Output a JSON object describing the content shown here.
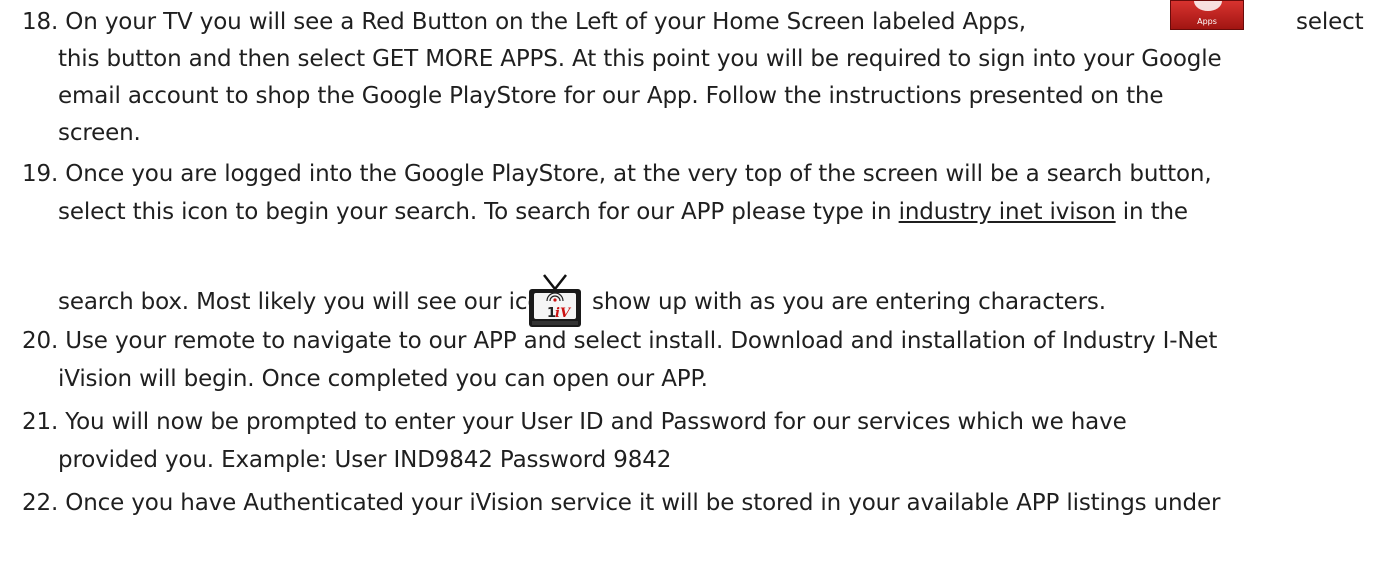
{
  "items": [
    {
      "lines": [
        "18. On your TV you will see a Red Button on the Left of your Home Screen labeled Apps,",
        "this button and then select GET MORE APPS.  At this point you will be required to sign into your Google",
        "email account to shop the Google PlayStore for our App.  Follow the instructions presented on the",
        "screen."
      ],
      "after_icon": "select"
    },
    {
      "lines": [
        "19. Once you are logged into the Google PlayStore, at the very top of the screen will be a search button,",
        "select this icon to begin your search.  To search for our APP please type in ",
        "search box.  Most likely you will see our icon",
        "show up with as you are entering characters."
      ],
      "underlined": "industry inet ivison",
      "after_underlined": " in the"
    },
    {
      "lines": [
        "20. Use your remote to navigate to our APP and select install. Download and installation of Industry I-Net",
        "iVision will begin.  Once completed you can open our APP."
      ]
    },
    {
      "lines": [
        "21. You will now be prompted to enter your User ID and Password for our services which we have",
        "provided you.   Example: User IND9842 Password 9842"
      ]
    },
    {
      "lines": [
        "22. Once you have Authenticated your iVision service it will be stored in your available APP listings under"
      ]
    }
  ],
  "apps_icon": {
    "label": "Apps",
    "color": "#c62320"
  },
  "tv_icon": {
    "label": "iV",
    "accent": "#cc1111"
  }
}
